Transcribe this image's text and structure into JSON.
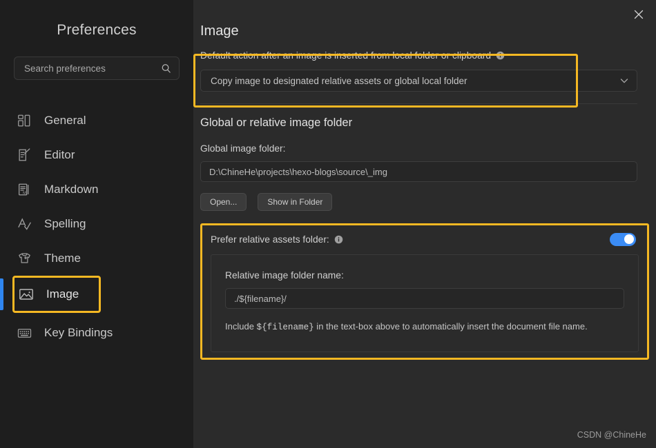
{
  "sidebar": {
    "title": "Preferences",
    "search": {
      "placeholder": "Search preferences",
      "value": "",
      "icon": "search-icon"
    },
    "items": [
      {
        "label": "General",
        "icon": "layout-blocks-icon",
        "active": false
      },
      {
        "label": "Editor",
        "icon": "document-pencil-icon",
        "active": false
      },
      {
        "label": "Markdown",
        "icon": "markdown-doc-icon",
        "active": false
      },
      {
        "label": "Spelling",
        "icon": "a-check-icon",
        "active": false
      },
      {
        "label": "Theme",
        "icon": "tshirt-icon",
        "active": false
      },
      {
        "label": "Image",
        "icon": "picture-icon",
        "active": true
      },
      {
        "label": "Key Bindings",
        "icon": "keyboard-icon",
        "active": false
      }
    ]
  },
  "titlebar": {
    "close_icon": "close-icon"
  },
  "main": {
    "page_title": "Image",
    "default_action": {
      "label": "Default action after an image is inserted from local folder or clipboard",
      "info_icon": "info-icon",
      "selected_option": "Copy image to designated relative assets or global local folder",
      "chevron_icon": "chevron-down-icon"
    },
    "folder_section": {
      "title": "Global or relative image folder",
      "global_label": "Global image folder:",
      "global_path": "D:\\ChineHe\\projects\\hexo-blogs\\source\\_img",
      "open_button": "Open...",
      "show_button": "Show in Folder"
    },
    "relative_assets": {
      "label": "Prefer relative assets folder:",
      "info_icon": "info-icon",
      "toggle_on": true,
      "relative_label": "Relative image folder name:",
      "relative_value": "./${filename}/",
      "hint_prefix": "Include ",
      "hint_code": "${filename}",
      "hint_suffix": " in the text-box above to automatically insert the document file name."
    }
  },
  "watermark": "CSDN @ChineHe",
  "colors": {
    "accent_annotation": "#f5b823",
    "accent_active": "#2f86f0",
    "toggle_on": "#3b8cf5",
    "sidebar_bg": "#1e1e1e",
    "main_bg": "#2b2b2b"
  }
}
